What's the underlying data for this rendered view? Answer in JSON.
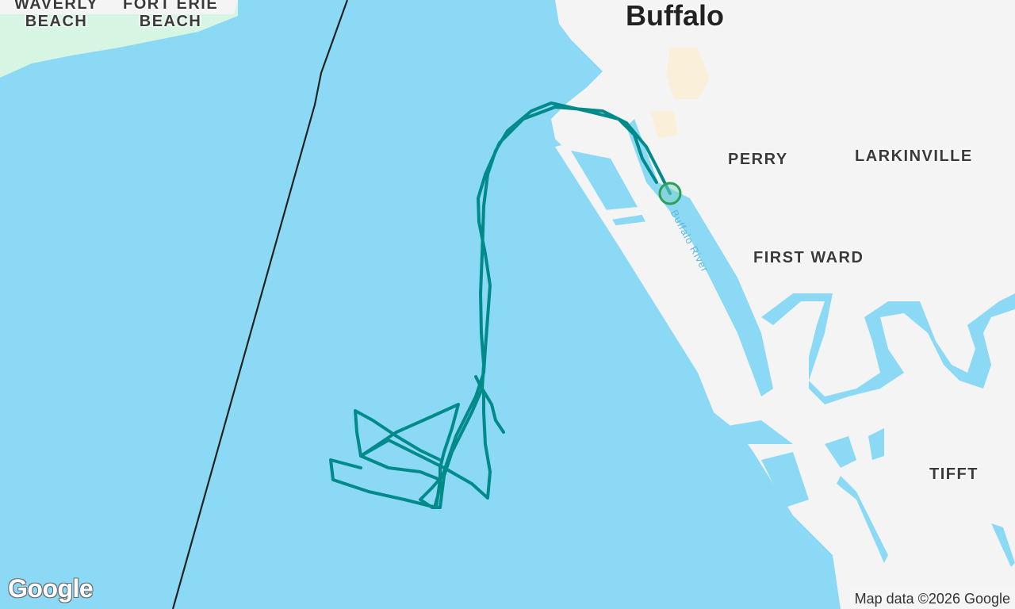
{
  "map": {
    "labels": {
      "waverly_beach": "WAVERLY\nBEACH",
      "fort_erie_beach": "FORT ERIE\nBEACH",
      "buffalo": "Buffalo",
      "perry": "PERRY",
      "larkinville": "LARKINVILLE",
      "first_ward": "FIRST WARD",
      "tifft": "TIFFT",
      "buffalo_river": "Buffalo River"
    },
    "colors": {
      "water": "#8bd9f5",
      "land": "#f4f4f4",
      "park": "#d6f5e3",
      "urban": "#faf0d9",
      "track": "#008a8a",
      "start_marker": "#2e9e5b",
      "border": "#222222"
    },
    "logo_text": "Google",
    "attribution": "Map data ©2026 Google",
    "start_marker_icon": "start-circle-icon"
  }
}
